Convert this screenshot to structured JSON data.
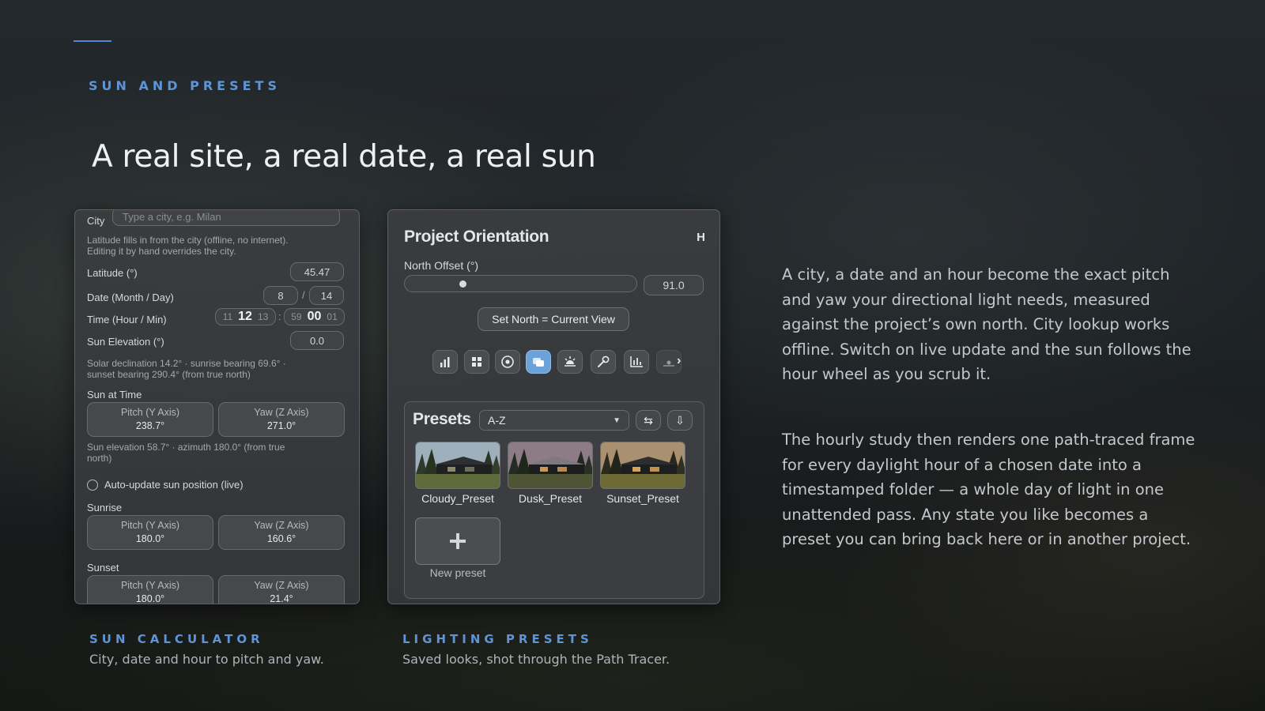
{
  "section": {
    "eyebrow": "SUN AND PRESETS",
    "headline": "A real site, a real date, a real sun"
  },
  "sun_calculator": {
    "city_label": "City",
    "city_placeholder": "Type a city, e.g. Milan",
    "city_hint_1": "Latitude fills in from the city (offline, no internet).",
    "city_hint_2": "Editing it by hand overrides the city.",
    "latitude_label": "Latitude (°)",
    "latitude_value": "45.47",
    "date_label": "Date (Month / Day)",
    "date_month": "8",
    "date_sep": "/",
    "date_day": "14",
    "time_label": "Time (Hour / Min)",
    "time_hour_prev": "11",
    "time_hour": "12",
    "time_hour_next": "13",
    "time_sep": ":",
    "time_min_prev": "59",
    "time_min": "00",
    "time_min_next": "01",
    "elevation_label": "Sun Elevation (°)",
    "elevation_value": "0.0",
    "solar_info_1": "Solar declination 14.2°  ·  sunrise bearing 69.6°  ·",
    "solar_info_2": "sunset bearing 290.4° (from true north)",
    "sun_at_time_label": "Sun at Time",
    "sun_at_time": {
      "pitch_title": "Pitch (Y Axis)",
      "pitch": "238.7°",
      "yaw_title": "Yaw (Z Axis)",
      "yaw": "271.0°"
    },
    "sun_at_time_info_1": "Sun elevation 58.7°  ·  azimuth 180.0° (from true",
    "sun_at_time_info_2": "north)",
    "auto_update_label": "Auto-update sun position (live)",
    "sunrise_label": "Sunrise",
    "sunrise": {
      "pitch_title": "Pitch (Y Axis)",
      "pitch": "180.0°",
      "yaw_title": "Yaw (Z Axis)",
      "yaw": "160.6°"
    },
    "sunset_label": "Sunset",
    "sunset": {
      "pitch_title": "Pitch (Y Axis)",
      "pitch": "180.0°",
      "yaw_title": "Yaw (Z Axis)",
      "yaw": "21.4°"
    }
  },
  "orientation": {
    "title": "Project Orientation",
    "corner_glyph": "H",
    "north_offset_label": "North Offset (°)",
    "north_offset_value": "91.0",
    "north_offset_fraction": 0.25,
    "set_north_button": "Set North = Current View",
    "toolbar_icons": [
      "bar-chart-icon",
      "grid-icon",
      "target-icon",
      "layers-icon",
      "sunrise-icon",
      "wrench-icon",
      "line-chart-icon",
      "sun-horizon-icon",
      "chevron-right-icon"
    ],
    "presets_title": "Presets",
    "sort_value": "A-Z",
    "presets": [
      {
        "name": "Cloudy_Preset",
        "sky": "#9fb0bd"
      },
      {
        "name": "Dusk_Preset",
        "sky": "#8d7b86"
      },
      {
        "name": "Sunset_Preset",
        "sky": "#a99070"
      }
    ],
    "new_preset_label": "New preset"
  },
  "captions": {
    "left_title": "SUN CALCULATOR",
    "left_text": "City, date and hour to pitch and yaw.",
    "right_title": "LIGHTING PRESETS",
    "right_text": "Saved looks, shot through the Path Tracer."
  },
  "body": {
    "paragraph_1": "A city, a date and an hour become the exact pitch and yaw your directional light needs, measured against the project’s own north. City lookup works offline. Switch on live update and the sun follows the hour wheel as you scrub it.",
    "paragraph_2": "The hourly study then renders one path-traced frame for every daylight hour of a chosen date into a timestamped folder — a whole day of light in one unattended pass. Any state you like becomes a preset you can bring back here or in another project."
  },
  "colors": {
    "accent": "#5d95d6",
    "active_tool": "#6da2d8"
  }
}
